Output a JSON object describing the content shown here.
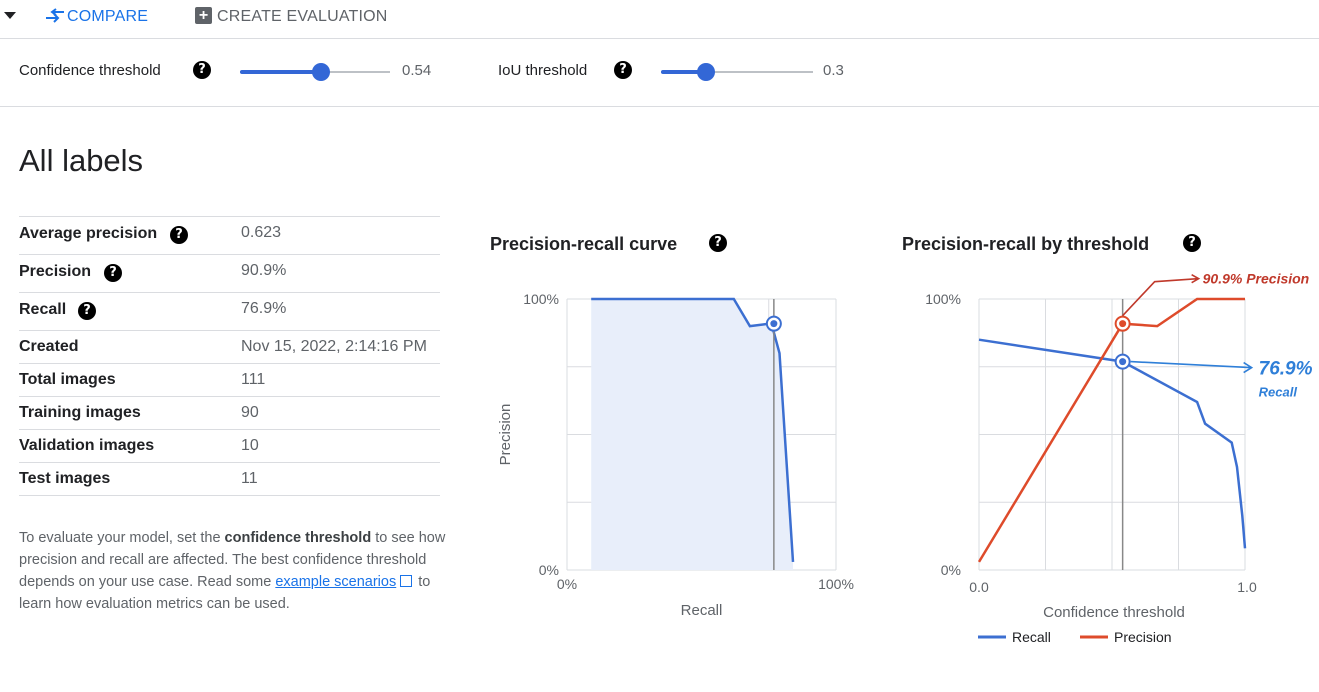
{
  "toolbar": {
    "compare_label": "COMPARE",
    "create_label": "CREATE EVALUATION"
  },
  "sliders": {
    "confidence": {
      "label": "Confidence threshold",
      "value": "0.54",
      "fraction": 0.54
    },
    "iou": {
      "label": "IoU threshold",
      "value": "0.3",
      "fraction": 0.3
    }
  },
  "section_title": "All labels",
  "stats": [
    {
      "label": "Average precision",
      "value": "0.623",
      "help": true
    },
    {
      "label": "Precision",
      "value": "90.9%",
      "help": true
    },
    {
      "label": "Recall",
      "value": "76.9%",
      "help": true
    },
    {
      "label": "Created",
      "value": "Nov 15, 2022, 2:14:16 PM",
      "help": false
    },
    {
      "label": "Total images",
      "value": "111",
      "help": false
    },
    {
      "label": "Training images",
      "value": "90",
      "help": false
    },
    {
      "label": "Validation images",
      "value": "10",
      "help": false
    },
    {
      "label": "Test images",
      "value": "11",
      "help": false
    }
  ],
  "info": {
    "text1": "To evaluate your model, set the ",
    "bold": "confidence threshold",
    "text2": " to see how precision and recall are affected. The best confidence threshold depends on your use case. Read some ",
    "link": "example scenarios",
    "text3": " to learn how evaluation metrics can be used."
  },
  "colors": {
    "blue": "#3c6fd1",
    "red": "#de4b2b",
    "annotation_red": "#c0392b",
    "annotation_blue": "#2f7fd8"
  },
  "chart_data": [
    {
      "type": "area",
      "title": "Precision-recall curve",
      "xlabel": "Recall",
      "ylabel": "Precision",
      "xtick_labels": [
        "0%",
        "100%"
      ],
      "ytick_labels": [
        "0%",
        "100%"
      ],
      "xlim": [
        0,
        1
      ],
      "ylim": [
        0,
        1
      ],
      "grid": true,
      "series": [
        {
          "points": [
            [
              0.09,
              1.0
            ],
            [
              0.62,
              1.0
            ],
            [
              0.68,
              0.9
            ],
            [
              0.76,
              0.91
            ],
            [
              0.79,
              0.8
            ],
            [
              0.84,
              0.03
            ]
          ]
        }
      ],
      "marker": {
        "x": 0.769,
        "y": 0.909
      }
    },
    {
      "type": "line",
      "title": "Precision-recall by threshold",
      "xlabel": "Confidence threshold",
      "xtick_labels": [
        "0.0",
        "1.0"
      ],
      "ytick_labels": [
        "0%",
        "100%"
      ],
      "xlim": [
        0,
        1
      ],
      "ylim": [
        0,
        1
      ],
      "grid": true,
      "legend_position": "bottom",
      "threshold": 0.54,
      "series": [
        {
          "name": "Recall",
          "points": [
            [
              0.0,
              0.85
            ],
            [
              0.54,
              0.769
            ],
            [
              0.82,
              0.62
            ],
            [
              0.85,
              0.54
            ],
            [
              0.95,
              0.47
            ],
            [
              0.97,
              0.38
            ],
            [
              0.99,
              0.2
            ],
            [
              1.0,
              0.08
            ]
          ]
        },
        {
          "name": "Precision",
          "points": [
            [
              0.0,
              0.03
            ],
            [
              0.54,
              0.909
            ],
            [
              0.67,
              0.9
            ],
            [
              0.82,
              1.0
            ],
            [
              1.0,
              1.0
            ]
          ]
        }
      ],
      "annotations": {
        "precision": {
          "text": "90.9% Precision"
        },
        "recall_value": {
          "text": "76.9%"
        },
        "recall_label": {
          "text": "Recall"
        }
      }
    }
  ]
}
